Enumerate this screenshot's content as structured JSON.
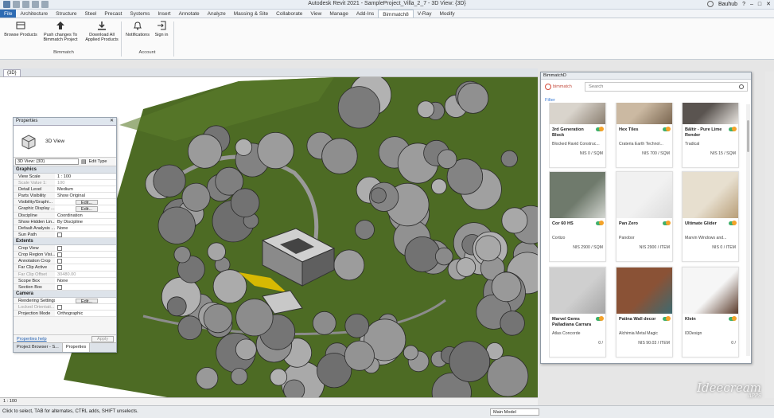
{
  "window": {
    "title": "Autodesk Revit 2021 - SampleProject_Villa_2_7 - 3D View: {3D}",
    "user": "Bauhub"
  },
  "ribbon_tabs": [
    "File",
    "Architecture",
    "Structure",
    "Steel",
    "Precast",
    "Systems",
    "Insert",
    "Annotate",
    "Analyze",
    "Massing & Site",
    "Collaborate",
    "View",
    "Manage",
    "Add-Ins",
    "Bimmatch8",
    "V-Ray",
    "Modify"
  ],
  "ribbon": {
    "buttons": [
      {
        "label": "Browse Products"
      },
      {
        "label": "Push changes To Bimmatch Project"
      },
      {
        "label": "Download All Applied Products"
      },
      {
        "label": "Notifications"
      },
      {
        "label": "Sign in"
      }
    ],
    "group_bimmatch": "Bimmatch",
    "group_account": "Account"
  },
  "view_tab": "{3D}",
  "properties": {
    "title": "Properties",
    "type_name": "3D View",
    "selector": "3D View: {3D}",
    "edit_type": "Edit Type",
    "sections": {
      "graphics": "Graphics",
      "extents": "Extents",
      "camera": "Camera"
    },
    "graphics_rows": [
      {
        "k": "View Scale",
        "v": "1 : 100"
      },
      {
        "k": "Scale Value 1:",
        "v": "100"
      },
      {
        "k": "Detail Level",
        "v": "Medium"
      },
      {
        "k": "Parts Visibility",
        "v": "Show Original"
      },
      {
        "k": "Visibility/Graphi...",
        "v": "Edit..."
      },
      {
        "k": "Graphic Display ...",
        "v": "Edit..."
      },
      {
        "k": "Discipline",
        "v": "Coordination"
      },
      {
        "k": "Show Hidden Lin...",
        "v": "By Discipline"
      },
      {
        "k": "Default Analysis ...",
        "v": "None"
      },
      {
        "k": "Sun Path",
        "v": ""
      }
    ],
    "extents_rows": [
      {
        "k": "Crop View",
        "v": ""
      },
      {
        "k": "Crop Region Visi...",
        "v": ""
      },
      {
        "k": "Annotation Crop",
        "v": ""
      },
      {
        "k": "Far Clip Active",
        "v": ""
      },
      {
        "k": "Far Clip Offset",
        "v": "30480.00"
      },
      {
        "k": "Scope Box",
        "v": "None"
      },
      {
        "k": "Section Box",
        "v": ""
      }
    ],
    "camera_rows": [
      {
        "k": "Rendering Settings",
        "v": "Edit..."
      },
      {
        "k": "Locked Orientati...",
        "v": ""
      },
      {
        "k": "Projection Mode",
        "v": "Orthographic"
      }
    ],
    "help": "Properties help",
    "apply": "Apply",
    "tab_browser": "Project Browser - S...",
    "tab_props": "Properties"
  },
  "bimmatch": {
    "title": "BimmatchD",
    "logo": "bimmatch",
    "search_placeholder": "Search",
    "filter": "Filter",
    "cards": [
      {
        "name": "3rd Generation Block",
        "brand": "Blocked Ravid Construc...",
        "price": "NIS 0 / SQM",
        "img": "#d9d4cc",
        "accent": "#8a7e70"
      },
      {
        "name": "Hex Tiles",
        "brand": "Crateria Earth Technol...",
        "price": "NIS 700 / SQM",
        "img": "#cbb9a2",
        "accent": "#7a6650"
      },
      {
        "name": "Bāltir - Pure Lime Render",
        "brand": "Tradical",
        "price": "NIS 15 / SQM",
        "img": "#5a5450",
        "accent": "#e8e4df"
      },
      {
        "name": "Cor 60 HS",
        "brand": "Cortizo",
        "price": "NIS 2900 / SQM",
        "img": "#6f7a6c",
        "accent": "#d4d7d2"
      },
      {
        "name": "Pan Zero",
        "brand": "Panobor",
        "price": "NIS 2900 / ITEM",
        "img": "#f1f1f1",
        "accent": "#dcdcdc"
      },
      {
        "name": "Ultimate Glider",
        "brand": "Marvin Windows and...",
        "price": "NIS 0 / ITEM",
        "img": "#e7dfcf",
        "accent": "#b89e78"
      },
      {
        "name": "Marvel Gems Palladiana Carrara",
        "brand": "Atlas Concorde",
        "price": "0 /",
        "img": "#cfcfcf",
        "accent": "#a5a5a5"
      },
      {
        "name": "Patina Wall decor",
        "brand": "Alchimia Metal Magic",
        "price": "NIS 90.03 / ITEM",
        "img": "#8a5236",
        "accent": "#3e6a70"
      },
      {
        "name": "Klein",
        "brand": "IDDesign",
        "price": "0 /",
        "img": "#f6f6f6",
        "accent": "#5a3a2a"
      }
    ]
  },
  "view_control": "1 : 100",
  "status_text": "Click to select, TAB for alternates, CTRL adds, SHIFT unselects.",
  "model_selector": "Main Model",
  "watermark": {
    "brand": "Ideecream",
    "sub": "APPS"
  },
  "colors": {
    "revit_blue": "#2d6bb3",
    "bimmatch_red": "#d44a3a",
    "terrain_green": "#4d6b24"
  }
}
